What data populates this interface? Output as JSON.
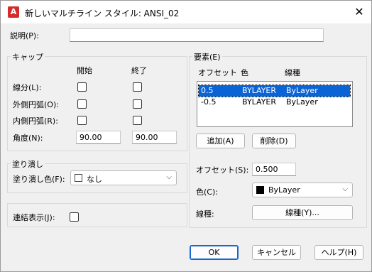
{
  "window": {
    "title": "新しいマルチライン スタイル: ANSI_02"
  },
  "description": {
    "label": "説明(P):",
    "value": ""
  },
  "caps": {
    "group_label": "キャップ",
    "col_start": "開始",
    "col_end": "終了",
    "line_label": "線分(L):",
    "outer_arc_label": "外側円弧(O):",
    "inner_arc_label": "内側円弧(R):",
    "angle_label": "角度(N):",
    "angle_start": "90.00",
    "angle_end": "90.00"
  },
  "fill": {
    "group_label": "塗り潰し",
    "color_label": "塗り潰し色(F):",
    "color_value": "なし"
  },
  "joints": {
    "label": "連結表示(J):"
  },
  "elements": {
    "group_label": "要素(E)",
    "headers": [
      "オフセット",
      "色",
      "線種"
    ],
    "rows": [
      {
        "offset": "0.5",
        "color": "BYLAYER",
        "linetype": "ByLayer"
      },
      {
        "offset": "-0.5",
        "color": "BYLAYER",
        "linetype": "ByLayer"
      }
    ],
    "add_label": "追加(A)",
    "delete_label": "削除(D)",
    "offset_label": "オフセット(S):",
    "offset_value": "0.500",
    "color_label": "色(C):",
    "color_value": "ByLayer",
    "linetype_label": "線種:",
    "linetype_button": "線種(Y)..."
  },
  "buttons": {
    "ok": "OK",
    "cancel": "キャンセル",
    "help": "ヘルプ(H)"
  },
  "colors": {
    "selection": "#0a64d6",
    "default_border": "#1a66d1",
    "app_icon": "#d52b2b"
  },
  "icons": {
    "app": "autocad-icon",
    "close": "close-icon",
    "dropdown": "chevron-down-icon"
  }
}
